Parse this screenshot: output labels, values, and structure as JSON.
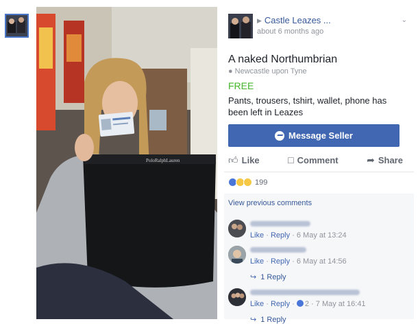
{
  "listing": {
    "group_name": "Castle Leazes ...",
    "time": "about 6 months ago",
    "title": "A naked Northumbrian",
    "location": "Newcastle upon Tyne",
    "price": "FREE",
    "description": "Pants, trousers, tshirt, wallet, phone has been left in Leazes"
  },
  "buttons": {
    "message_seller": "Message Seller",
    "like": "Like",
    "comment": "Comment",
    "share": "Share"
  },
  "reactions": {
    "count": "199"
  },
  "comments": {
    "view_previous": "View previous comments",
    "items": [
      {
        "meta_like": "Like",
        "meta_reply": "Reply",
        "meta_time": "6 May at 13:24"
      },
      {
        "meta_like": "Like",
        "meta_reply": "Reply",
        "meta_time": "6 May at 14:56",
        "reply": "1 Reply"
      },
      {
        "meta_like": "Like",
        "meta_reply": "Reply",
        "reaction_count": "2",
        "meta_time": "7 May at 16:41",
        "reply": "1 Reply"
      }
    ]
  },
  "photo": {
    "pants_brand": "PoloRalphLauren"
  },
  "colors": {
    "accent": "#4267b2",
    "price_green": "#42b72a",
    "link": "#365899"
  }
}
